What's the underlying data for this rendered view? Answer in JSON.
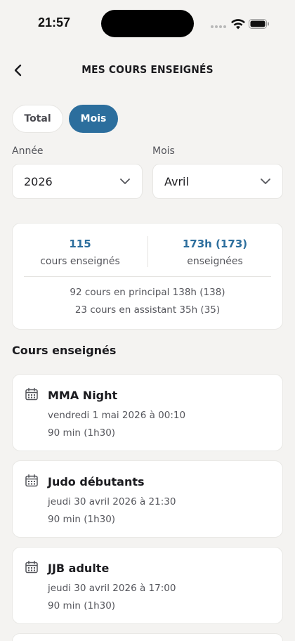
{
  "status_bar": {
    "time": "21:57"
  },
  "header": {
    "title": "MES COURS ENSEIGNÉS"
  },
  "segment": {
    "total_label": "Total",
    "mois_label": "Mois",
    "selected": "Mois"
  },
  "filters": {
    "year_label": "Année",
    "year_value": "2026",
    "month_label": "Mois",
    "month_value": "Avril"
  },
  "stats": {
    "courses_count": "115",
    "courses_label": "cours enseignés",
    "hours_value": "173h (173)",
    "hours_label": "enseignées",
    "principal_line": "92 cours en principal 138h (138)",
    "assistant_line": "23 cours en assistant 35h (35)"
  },
  "section": {
    "title": "Cours enseignés"
  },
  "courses": [
    {
      "name": "MMA Night",
      "date": "vendredi 1 mai 2026 à 00:10",
      "duration": "90 min (1h30)"
    },
    {
      "name": "Judo débutants",
      "date": "jeudi 30 avril 2026 à 21:30",
      "duration": "90 min (1h30)"
    },
    {
      "name": "JJB adulte",
      "date": "jeudi 30 avril 2026 à 17:00",
      "duration": "90 min (1h30)"
    }
  ],
  "colors": {
    "accent": "#2c6e9d",
    "background": "#f4f3f1",
    "card": "#ffffff"
  }
}
